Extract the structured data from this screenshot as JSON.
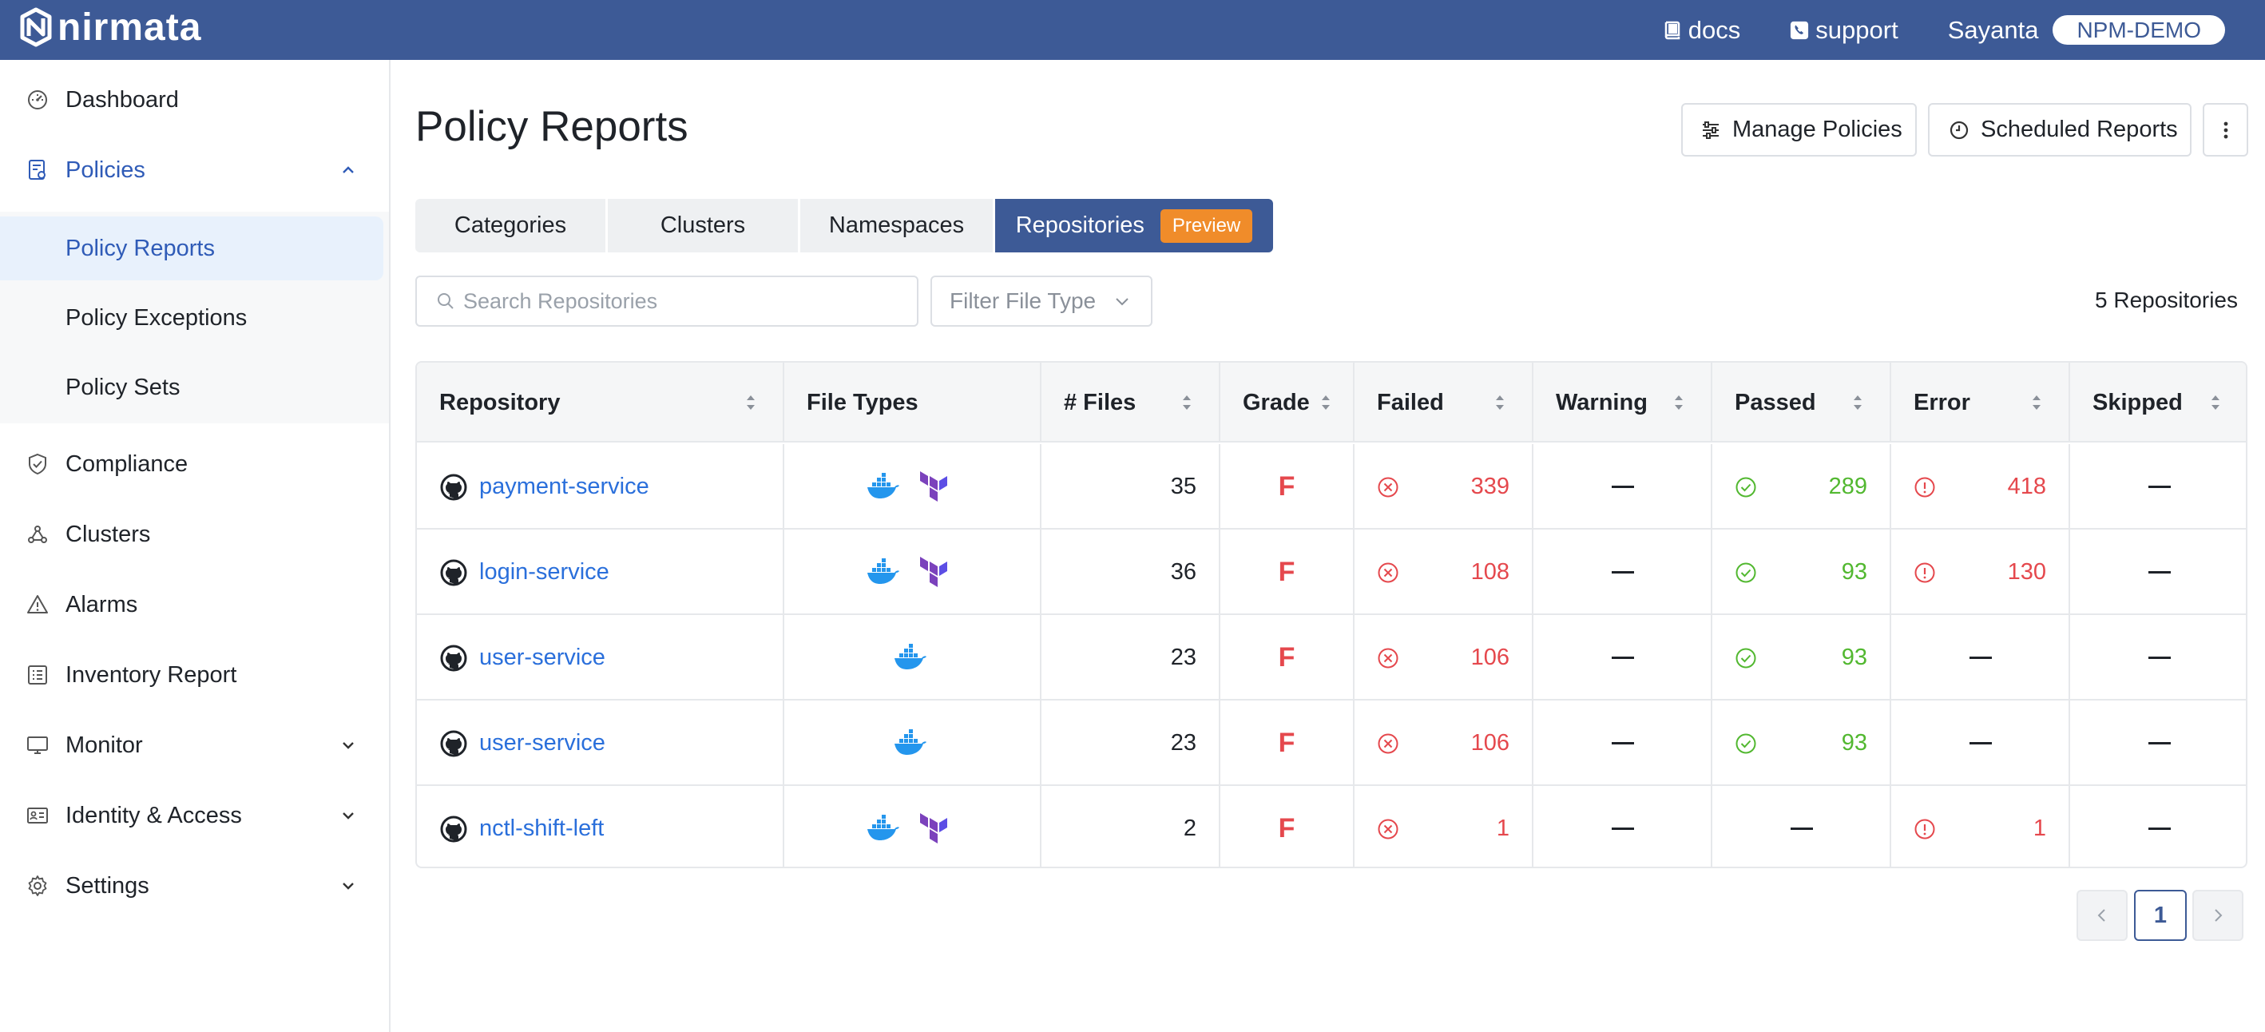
{
  "brand": {
    "name": "nirmata"
  },
  "topbar": {
    "docs_label": "docs",
    "support_label": "support",
    "user_name": "Sayanta",
    "org_label": "NPM-DEMO"
  },
  "sidebar": {
    "items": [
      {
        "label": "Dashboard",
        "icon": "dashboard-icon"
      },
      {
        "label": "Policies",
        "icon": "policy-icon",
        "expanded": true
      },
      {
        "label": "Compliance",
        "icon": "shield-check-icon"
      },
      {
        "label": "Clusters",
        "icon": "clusters-icon"
      },
      {
        "label": "Alarms",
        "icon": "warning-icon"
      },
      {
        "label": "Inventory Report",
        "icon": "list-icon"
      },
      {
        "label": "Monitor",
        "icon": "monitor-icon"
      },
      {
        "label": "Identity & Access",
        "icon": "id-card-icon"
      },
      {
        "label": "Settings",
        "icon": "gear-icon"
      }
    ],
    "policies_sub": [
      {
        "label": "Policy Reports",
        "selected": true
      },
      {
        "label": "Policy Exceptions"
      },
      {
        "label": "Policy Sets"
      }
    ]
  },
  "page": {
    "title": "Policy Reports",
    "manage_label": "Manage Policies",
    "scheduled_label": "Scheduled Reports"
  },
  "tabs": [
    {
      "label": "Categories"
    },
    {
      "label": "Clusters"
    },
    {
      "label": "Namespaces"
    },
    {
      "label": "Repositories",
      "active": true,
      "badge": "Preview"
    }
  ],
  "search": {
    "placeholder": "Search Repositories",
    "value": ""
  },
  "filter": {
    "placeholder": "Filter File Type"
  },
  "repo_count": "5 Repositories",
  "table": {
    "columns": [
      "Repository",
      "File Types",
      "# Files",
      "Grade",
      "Failed",
      "Warning",
      "Passed",
      "Error",
      "Skipped"
    ],
    "rows": [
      {
        "repository": "payment-service",
        "file_types": [
          "docker",
          "terraform"
        ],
        "files": "35",
        "grade": "F",
        "failed": "339",
        "warning": null,
        "passed": "289",
        "error": "418",
        "skipped": null
      },
      {
        "repository": "login-service",
        "file_types": [
          "docker",
          "terraform"
        ],
        "files": "36",
        "grade": "F",
        "failed": "108",
        "warning": null,
        "passed": "93",
        "error": "130",
        "skipped": null
      },
      {
        "repository": "user-service",
        "file_types": [
          "docker"
        ],
        "files": "23",
        "grade": "F",
        "failed": "106",
        "warning": null,
        "passed": "93",
        "error": null,
        "skipped": null
      },
      {
        "repository": "user-service",
        "file_types": [
          "docker"
        ],
        "files": "23",
        "grade": "F",
        "failed": "106",
        "warning": null,
        "passed": "93",
        "error": null,
        "skipped": null
      },
      {
        "repository": "nctl-shift-left",
        "file_types": [
          "docker",
          "terraform"
        ],
        "files": "2",
        "grade": "F",
        "failed": "1",
        "warning": null,
        "passed": null,
        "error": "1",
        "skipped": null
      }
    ]
  },
  "pagination": {
    "current": "1"
  },
  "colors": {
    "header_bg": "#3d5a96",
    "link": "#2a6fdb",
    "failed": "#e5484d",
    "passed": "#52b830",
    "badge": "#f08c2a"
  }
}
